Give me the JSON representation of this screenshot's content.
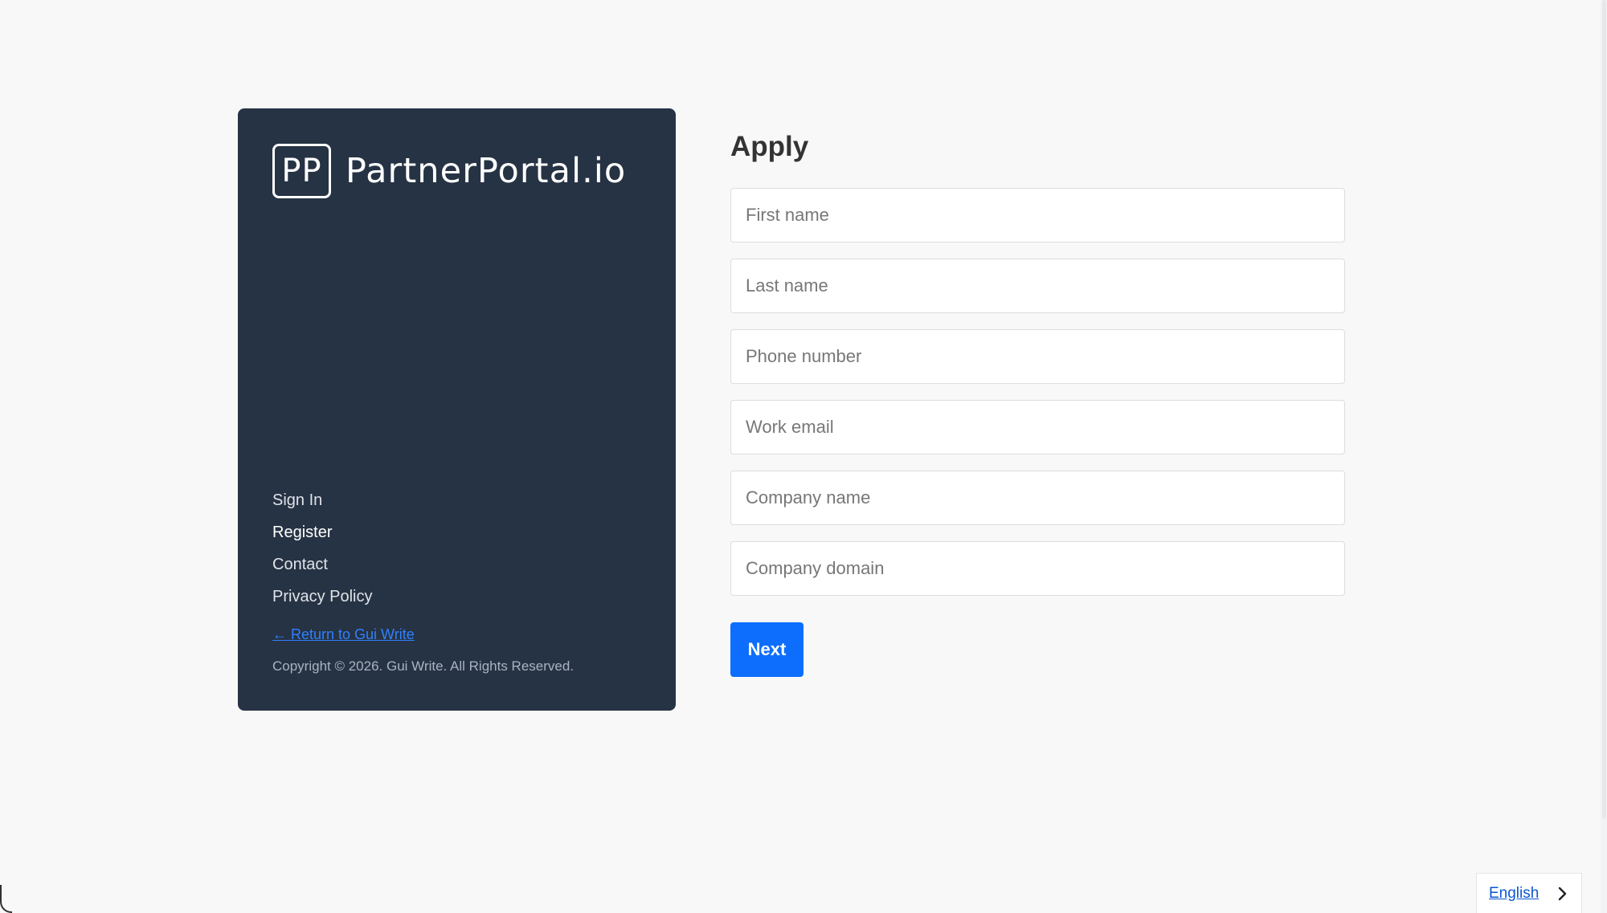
{
  "brand": {
    "mark": "PP",
    "name": "PartnerPortal.io"
  },
  "nav": {
    "items": [
      {
        "label": "Sign In"
      },
      {
        "label": "Register"
      },
      {
        "label": "Contact"
      },
      {
        "label": "Privacy Policy"
      }
    ],
    "active": "Register"
  },
  "footer": {
    "return_link": "← Return to Gui Write",
    "copyright": "Copyright © 2026. Gui Write. All Rights Reserved."
  },
  "form": {
    "title": "Apply",
    "fields": [
      {
        "placeholder": "First name",
        "value": ""
      },
      {
        "placeholder": "Last name",
        "value": ""
      },
      {
        "placeholder": "Phone number",
        "value": ""
      },
      {
        "placeholder": "Work email",
        "value": ""
      },
      {
        "placeholder": "Company name",
        "value": ""
      },
      {
        "placeholder": "Company domain",
        "value": ""
      }
    ],
    "submit_label": "Next"
  },
  "language": {
    "selected": "English",
    "icon": "chevron-right-icon"
  },
  "colors": {
    "page_background": "#f8f8f9",
    "sidebar_background": "#263344",
    "primary": "#0d6efd",
    "link": "#2f80ff"
  }
}
